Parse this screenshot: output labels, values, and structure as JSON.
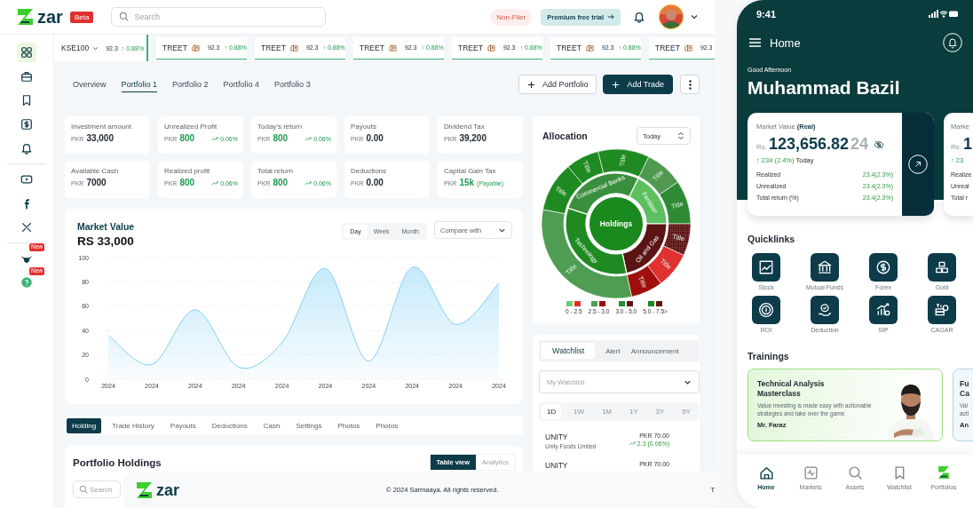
{
  "header": {
    "logo": "zar",
    "badge": "Beta",
    "search": {
      "placeholder": "Search"
    },
    "tax_status": "Non-Filer",
    "trial_button": "Premium free trial"
  },
  "sidebar": {
    "groups": [
      [
        {
          "selected": true
        },
        {
          "selected": false
        },
        {
          "selected": false
        },
        {
          "selected": false
        },
        {
          "selected": false
        }
      ],
      [
        {
          "selected": false
        },
        {
          "selected": false
        },
        {
          "selected": false
        }
      ],
      [
        {
          "selected": false,
          "badge": "New"
        },
        {
          "selected": false,
          "badge": "New"
        }
      ]
    ]
  },
  "ticker": {
    "index": {
      "name": "KSE100",
      "value": "92.3",
      "change": "↑ 0.88%"
    },
    "items": [
      {
        "symbol": "TREET",
        "value": "92.3",
        "change": "↑ 0.88%"
      },
      {
        "symbol": "TREET",
        "value": "92.3",
        "change": "↑ 0.88%"
      },
      {
        "symbol": "TREET",
        "value": "92.3",
        "change": "↑ 0.88%"
      },
      {
        "symbol": "TREET",
        "value": "92.3",
        "change": "↑ 0.88%"
      },
      {
        "symbol": "TREET",
        "value": "92.3",
        "change": "↑ 0.88%"
      },
      {
        "symbol": "TREET",
        "value": "92.3"
      }
    ]
  },
  "portfolio_tabs": [
    {
      "label": "Overview",
      "selected": false
    },
    {
      "label": "Portfolio 1",
      "selected": true
    },
    {
      "label": "Portfolio 2",
      "selected": false
    },
    {
      "label": "Portfolio 4",
      "selected": false
    },
    {
      "label": "Portfolio 3",
      "selected": false
    }
  ],
  "actions": [
    {
      "label": "Add Portfolio",
      "kind": "outline"
    },
    {
      "label": "Add Trade",
      "kind": "solid"
    }
  ],
  "stats": [
    {
      "label": "Investment amount",
      "currency": "PKR",
      "value": "33,000",
      "highlighted": false
    },
    {
      "label": "Unrealized Profit",
      "currency": "PKR",
      "value": "800",
      "highlighted": true,
      "change": "0.06%"
    },
    {
      "label": "Today’s return",
      "currency": "PKR",
      "value": "800",
      "highlighted": true,
      "change": "0.06%"
    },
    {
      "label": "Payouts",
      "currency": "PKR",
      "value": "0.00",
      "highlighted": false
    },
    {
      "label": "Dividend Tax",
      "currency": "PKR",
      "value": "39,200",
      "highlighted": false
    },
    {
      "label": "Available Cash",
      "currency": "PKR",
      "value": "7000",
      "highlighted": false
    },
    {
      "label": "Realized profit",
      "currency": "PKR",
      "value": "800",
      "highlighted": true,
      "change": "0.06%"
    },
    {
      "label": "Total return",
      "currency": "PKR",
      "value": "800",
      "highlighted": true,
      "change": "0.06%"
    },
    {
      "label": "Deductions",
      "currency": "PKR",
      "value": "0.00",
      "highlighted": false
    },
    {
      "label": "Capital Gain Tax",
      "currency": "PKR",
      "value": "15k",
      "highlighted": true,
      "note": "(Payable)"
    }
  ],
  "market_value": {
    "title": "Market Value",
    "value": "RS 33,000",
    "ranges": [
      {
        "label": "Day",
        "selected": true
      },
      {
        "label": "Week",
        "selected": false
      },
      {
        "label": "Month",
        "selected": false
      }
    ],
    "compare": {
      "placeholder": "Compare with"
    },
    "chart_data": {
      "type": "area",
      "grid": true,
      "categories": [
        "2024",
        "2024",
        "2024",
        "2024",
        "2024",
        "2024",
        "2024",
        "2024",
        "2024",
        "2024"
      ],
      "series": [
        {
          "color": "#7fd0f5",
          "values": [
            36,
            12,
            57,
            10,
            30,
            91,
            15,
            92,
            45,
            79
          ]
        }
      ],
      "ylim": [
        0,
        100
      ],
      "yticks": [
        0,
        20,
        40,
        60,
        80,
        100
      ]
    }
  },
  "holding_tabs": [
    {
      "label": "Holding",
      "selected": true
    },
    {
      "label": "Trade History",
      "selected": false
    },
    {
      "label": "Payouts",
      "selected": false
    },
    {
      "label": "Deductions",
      "selected": false
    },
    {
      "label": "Cash",
      "selected": false
    },
    {
      "label": "Settings",
      "selected": false
    },
    {
      "label": "Photos",
      "selected": false
    },
    {
      "label": "Photos",
      "selected": false
    }
  ],
  "holdings": {
    "title": "Portfolio Holdings",
    "views": [
      {
        "label": "Table view",
        "selected": true
      },
      {
        "label": "Analytics",
        "selected": false
      }
    ],
    "search": {
      "placeholder": "Search"
    }
  },
  "allocation": {
    "title": "Allocation",
    "period": "Today",
    "center": "Holdings",
    "sectors": [
      {
        "label": "Commercial Banks",
        "color": "#3a8f3e"
      },
      {
        "label": "Fertilizer",
        "color": "#5cc05f"
      },
      {
        "label": "Oil and Gas",
        "color": "#5b1414"
      },
      {
        "label": "Technology",
        "color": "#1f8a22"
      }
    ],
    "segments": [
      {
        "label": "Title",
        "color": "#1f8a22",
        "kind": "solid"
      },
      {
        "label": "Title",
        "color": "#1f8a22",
        "kind": "solid"
      },
      {
        "label": "Title",
        "color": "#1f8a22",
        "kind": "solid"
      },
      {
        "label": "Title",
        "color": "#4f9a50",
        "kind": "solid"
      },
      {
        "label": "Title",
        "color": "#2e8b34",
        "kind": "solid"
      },
      {
        "label": "Title",
        "color": "#5c1515",
        "kind": "dotted"
      },
      {
        "label": "Title",
        "color": "#e03030",
        "kind": "solid"
      },
      {
        "label": "Title",
        "color": "#a00d0d",
        "kind": "solid"
      },
      {
        "label": "Title",
        "color": "#4f9d52",
        "kind": "solid"
      }
    ],
    "legend": [
      {
        "label": "0 - 2.5",
        "swatches": [
          {
            "color": "#6fcf6f"
          },
          {
            "color": "#e03030"
          }
        ]
      },
      {
        "label": "2.5 - 3.0",
        "swatches": [
          {
            "color": "#4f9d52"
          },
          {
            "color": "#a00d0d"
          }
        ]
      },
      {
        "label": "3.0 - 5.0",
        "swatches": [
          {
            "color": "#2e8b34"
          },
          {
            "color": "#5c1515"
          }
        ]
      },
      {
        "label": "5.0 - 7.5>",
        "swatches": [
          {
            "color": "#1a8a1e"
          },
          {
            "color": "#5c1515"
          }
        ]
      }
    ]
  },
  "watchlist": {
    "tabs": [
      {
        "label": "Watchlist",
        "selected": true
      },
      {
        "label": "Alert",
        "selected": false
      },
      {
        "label": "Announcement",
        "selected": false
      }
    ],
    "list": {
      "placeholder": "My Watchlist"
    },
    "periods": [
      {
        "label": "1D",
        "selected": true
      },
      {
        "label": "1W",
        "selected": false
      },
      {
        "label": "1M",
        "selected": false
      },
      {
        "label": "1Y",
        "selected": false
      },
      {
        "label": "3Y",
        "selected": false
      },
      {
        "label": "5Y",
        "selected": false
      }
    ],
    "rows": [
      {
        "symbol": "UNITY",
        "name": "Unity Foods Limited",
        "price": "PKR 70.00",
        "change": "2.3 (0.06%)"
      },
      {
        "symbol": "UNITY",
        "price": "PKR 70.00"
      }
    ]
  },
  "footer": {
    "logo": "zar",
    "copyright": "© 2024 Sarmaaya. All rights reserved.",
    "trailing": "T"
  },
  "phone": {
    "time": "9:41",
    "title": "Home",
    "greeting": "Good Afternoon",
    "user": "Muhammad Bazil",
    "cards": [
      {
        "kind": "primary",
        "label": "Market Value **(Real)**",
        "currency": "Rs.",
        "value": "123,656.82",
        "value_faded": "24",
        "change": "↑ 234 (2.4%)",
        "change_suffix": "Today",
        "rows": [
          {
            "label": "Realized",
            "value": "23.4(2.3%)"
          },
          {
            "label": "Unrealized",
            "value": "23.4(2.3%)"
          },
          {
            "label": "Total return (%)",
            "value": "23.4(2.3%)"
          }
        ]
      },
      {
        "kind": "peek",
        "label": "Marke",
        "currency": "Rs.",
        "value": "1",
        "change": "↑ 23",
        "rows": [
          {
            "label": "Realize"
          },
          {
            "label": "Unreal"
          },
          {
            "label": "Total r"
          }
        ]
      }
    ],
    "quicklinks": {
      "title": "Quicklinks",
      "items": [
        "Stock",
        "Mutual Funds",
        "Forex",
        "Gold",
        "ROI",
        "Deduction",
        "SIP",
        "CAGAR"
      ]
    },
    "trainings": {
      "title": "Trainings",
      "items": [
        {
          "kind": "full",
          "title": "Technical Analysis Masterclass",
          "description": "Value investing is made easy with actionable strategies and take over the game",
          "author": "Mr. Faraz"
        },
        {
          "kind": "peek",
          "title_lines": [
            "Fu",
            "Ca"
          ],
          "description_lines": [
            "Val",
            "acti"
          ],
          "author": "An"
        }
      ]
    },
    "nav": [
      {
        "label": "Home",
        "selected": true
      },
      {
        "label": "Markets",
        "selected": false
      },
      {
        "label": "Assets",
        "selected": false
      },
      {
        "label": "Watchlist",
        "selected": false
      },
      {
        "label": "Portfolios",
        "selected": false
      }
    ]
  }
}
